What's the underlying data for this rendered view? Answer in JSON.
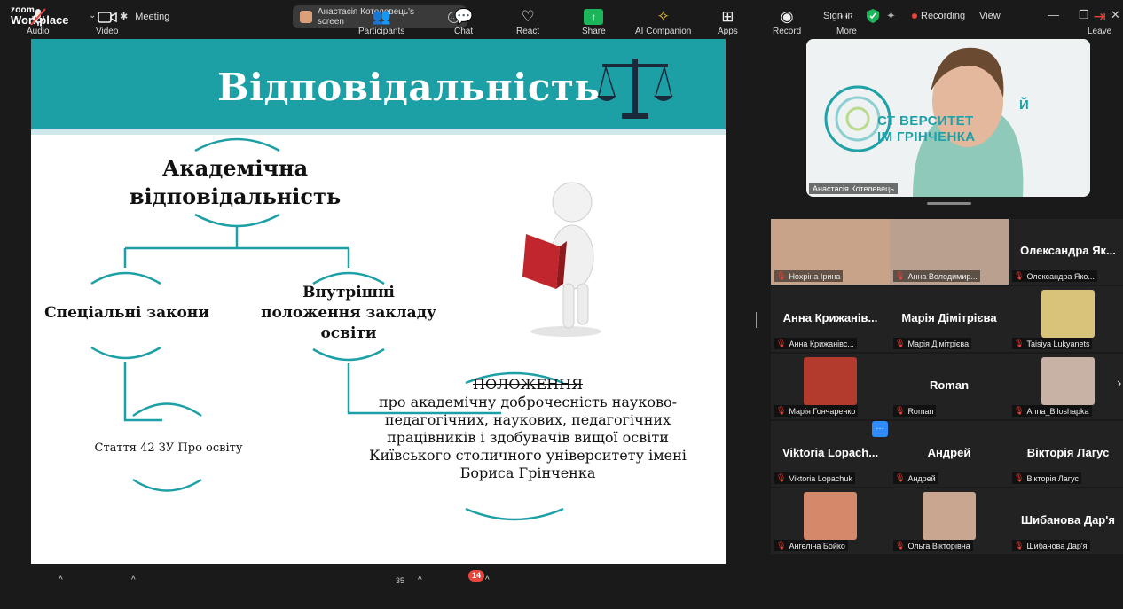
{
  "app": {
    "brand_top": "zoom",
    "brand_bottom": "Workplace"
  },
  "topbar": {
    "meeting_label": "Meeting",
    "screen_share_label": "Анастасія Котелевець's screen",
    "sign_in": "Sign in",
    "recording": "Recording",
    "view": "View"
  },
  "slide": {
    "title": "Відповідальність",
    "academic": "Академічна відповідальність",
    "special_laws": "Спеціальні закони",
    "internal": "Внутрішні положення закладу освіти",
    "article": "Стаття 42 ЗУ Про освіту",
    "regulation_head": "ПОЛОЖЕННЯ",
    "regulation_body": "про академічну доброчесність науково-педагогічних, наукових, педагогічних працівників і здобувачів вищої освіти Київського столичного університету імені Бориса Грінченка"
  },
  "speaker": {
    "name": "Анастасія Котелевець",
    "bg_text_line1": "Й",
    "bg_text_line2": "СТ           ВЕРСИТЕТ",
    "bg_text_line3": "ІМ            ГРІНЧЕНКА"
  },
  "participants": [
    {
      "name": "Нохріна Ірина",
      "display": "",
      "video": true,
      "color": "#c9a28a"
    },
    {
      "name": "Анна Володимир...",
      "display": "",
      "video": true,
      "color": "#b9a08f"
    },
    {
      "name": "Олександра Яко...",
      "display": "Олександра Як...",
      "video": false
    },
    {
      "name": "Анна Крижанівс...",
      "display": "Анна Крижанів...",
      "video": false
    },
    {
      "name": "Марія Дімітрієва",
      "display": "Марія Дімітрієва",
      "video": false
    },
    {
      "name": "Taisiya Lukyanets",
      "display": "",
      "video": true,
      "color": "#d9c27a"
    },
    {
      "name": "Марія Гончаренко",
      "display": "",
      "video": true,
      "color": "#b23b2e"
    },
    {
      "name": "Roman",
      "display": "Roman",
      "video": false
    },
    {
      "name": "Anna_Biloshapka",
      "display": "",
      "video": true,
      "color": "#c7b2a5"
    },
    {
      "name": "Viktoria Lopachuk",
      "display": "Viktoria Lopach...",
      "video": false
    },
    {
      "name": "Андрей",
      "display": "Андрей",
      "video": false
    },
    {
      "name": "Вікторія Лагус",
      "display": "Вікторія Лагус",
      "video": false
    },
    {
      "name": "Ангеліна Бойко",
      "display": "",
      "video": true,
      "color": "#d48a6a"
    },
    {
      "name": "Ольга Вікторівна",
      "display": "",
      "video": true,
      "color": "#c8a690"
    },
    {
      "name": "Шибанова Дар'я",
      "display": "Шибанова Дар'я",
      "video": false
    }
  ],
  "toolbar": {
    "audio": "Audio",
    "video": "Video",
    "participants": "Participants",
    "participants_count": "35",
    "chat": "Chat",
    "chat_badge": "14",
    "react": "React",
    "share": "Share",
    "ai": "AI Companion",
    "apps": "Apps",
    "record": "Record",
    "more": "More",
    "leave": "Leave"
  },
  "colors": {
    "accent": "#1d9fa6",
    "share_green": "#1cb55a",
    "leave_red": "#e8463c",
    "recording_red": "#e8463c"
  }
}
